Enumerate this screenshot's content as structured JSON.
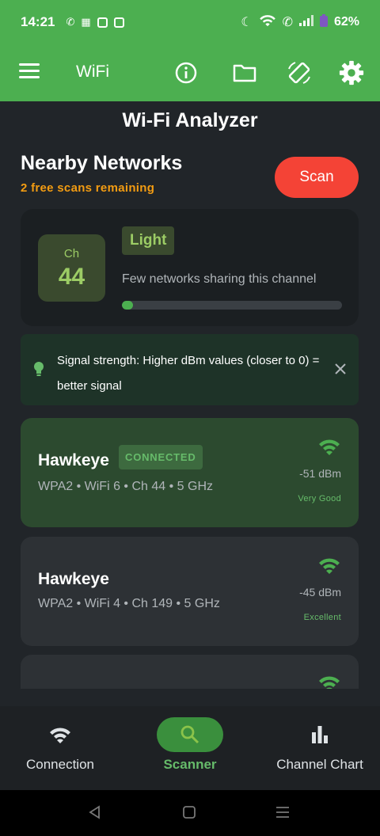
{
  "status_bar": {
    "time": "14:21",
    "battery": "62%"
  },
  "toolbar": {
    "title": "WiFi"
  },
  "app_title": "Wi-Fi Analyzer",
  "section": {
    "title": "Nearby Networks",
    "scans_remaining": "2 free scans remaining",
    "scan_label": "Scan"
  },
  "channel_card": {
    "ch_label": "Ch",
    "channel": "44",
    "congestion": "Light",
    "description": "Few networks sharing this channel",
    "congestion_level": 0.05
  },
  "tip": {
    "text": "Signal strength: Higher dBm values (closer to 0) = better signal"
  },
  "networks": [
    {
      "ssid": "Hawkeye",
      "badge": "CONNECTED",
      "meta": "WPA2 • WiFi 6 • Ch 44 • 5 GHz",
      "dbm": "-51 dBm",
      "quality": "Very Good"
    },
    {
      "ssid": "Hawkeye",
      "meta": "WPA2 • WiFi 4 • Ch 149 • 5 GHz",
      "dbm": "-45 dBm",
      "quality": "Excellent"
    }
  ],
  "bottom_nav": {
    "connection": "Connection",
    "scanner": "Scanner",
    "channel_chart": "Channel Chart"
  },
  "colors": {
    "accent": "#4caf50",
    "scan": "#f44336",
    "warning": "#f39c12"
  }
}
